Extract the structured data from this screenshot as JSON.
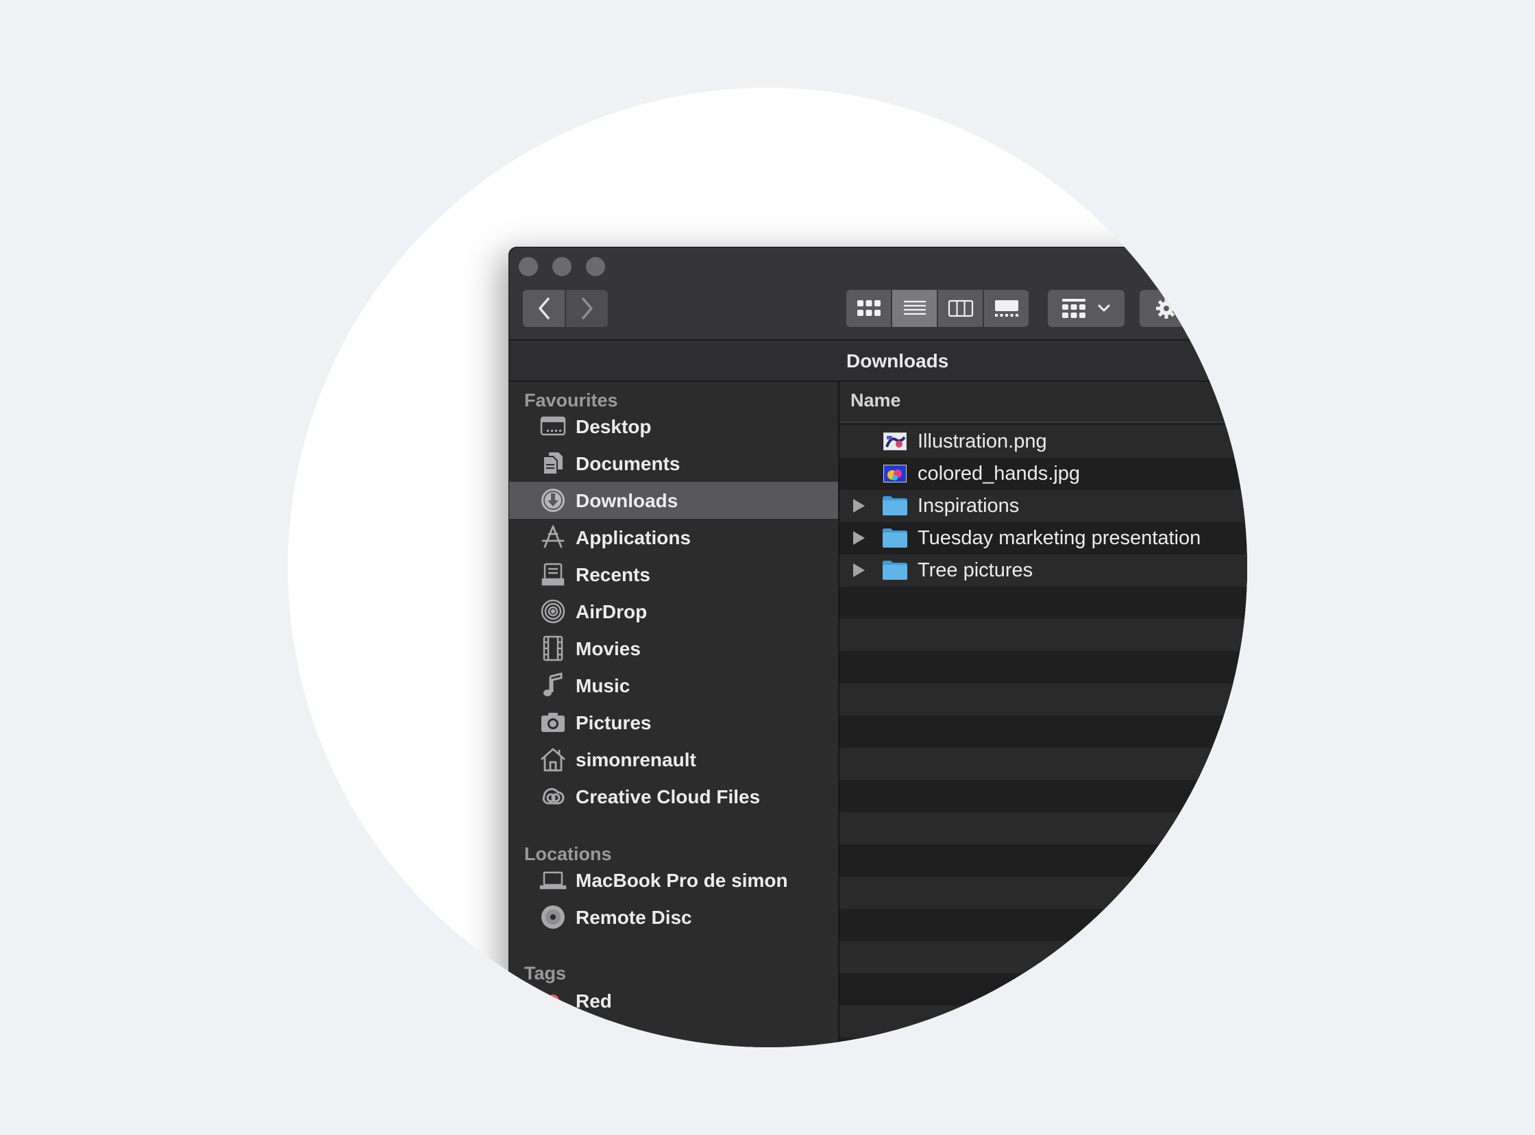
{
  "colors": {
    "page_background": "#f0f1f5",
    "window_background": "#2a2a2b",
    "selection": "#58585a",
    "folder_blue": "#5fb4e8"
  },
  "window": {
    "path_title": "Downloads",
    "column_header": "Name"
  },
  "toolbar": {
    "back_icon": "chevron-left-icon",
    "forward_icon": "chevron-right-icon",
    "views": [
      {
        "icon": "icon-view-icon",
        "active": false
      },
      {
        "icon": "list-view-icon",
        "active": true
      },
      {
        "icon": "column-view-icon",
        "active": false
      },
      {
        "icon": "gallery-view-icon",
        "active": false
      }
    ],
    "group_icon": "group-by-icon",
    "action_icon": "gear-icon"
  },
  "sidebar": {
    "favourites_label": "Favourites",
    "favourites": [
      {
        "label": "Desktop",
        "icon": "desktop-icon",
        "selected": false
      },
      {
        "label": "Documents",
        "icon": "documents-icon",
        "selected": false
      },
      {
        "label": "Downloads",
        "icon": "downloads-icon",
        "selected": true
      },
      {
        "label": "Applications",
        "icon": "applications-icon",
        "selected": false
      },
      {
        "label": "Recents",
        "icon": "recents-icon",
        "selected": false
      },
      {
        "label": "AirDrop",
        "icon": "airdrop-icon",
        "selected": false
      },
      {
        "label": "Movies",
        "icon": "movies-icon",
        "selected": false
      },
      {
        "label": "Music",
        "icon": "music-icon",
        "selected": false
      },
      {
        "label": "Pictures",
        "icon": "pictures-icon",
        "selected": false
      },
      {
        "label": "simonrenault",
        "icon": "home-icon",
        "selected": false
      },
      {
        "label": "Creative Cloud Files",
        "icon": "creative-cloud-icon",
        "selected": false
      }
    ],
    "locations_label": "Locations",
    "locations": [
      {
        "label": "MacBook Pro de simon",
        "icon": "laptop-icon"
      },
      {
        "label": "Remote Disc",
        "icon": "disc-icon"
      }
    ],
    "tags_label": "Tags",
    "tags": [
      {
        "label": "Red",
        "icon": "tag-dot-icon"
      }
    ]
  },
  "files": [
    {
      "name": "Illustration.png",
      "type": "image",
      "expandable": false
    },
    {
      "name": "colored_hands.jpg",
      "type": "image",
      "expandable": false
    },
    {
      "name": "Inspirations",
      "type": "folder",
      "expandable": true
    },
    {
      "name": "Tuesday marketing presentation",
      "type": "folder",
      "expandable": true
    },
    {
      "name": "Tree pictures",
      "type": "folder",
      "expandable": true
    }
  ]
}
